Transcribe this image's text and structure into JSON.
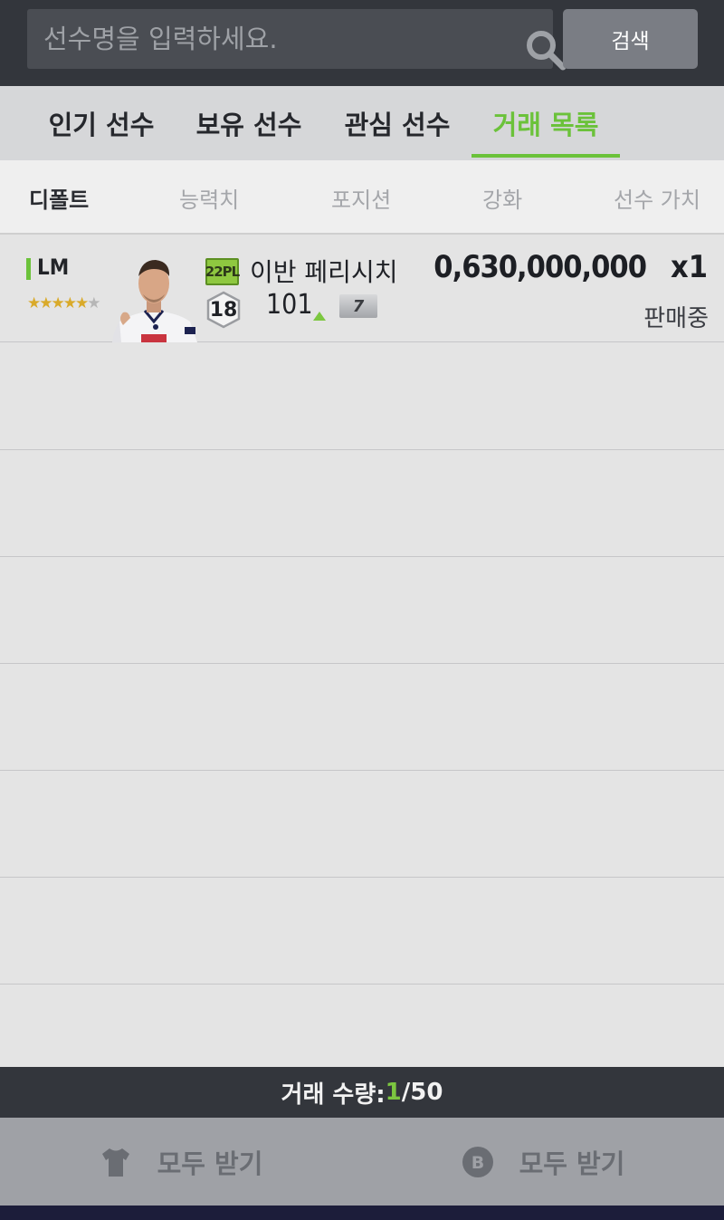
{
  "search": {
    "placeholder": "선수명을 입력하세요.",
    "button_label": "검색",
    "icon": "search-icon"
  },
  "tabs": [
    {
      "label": "인기 선수",
      "active": false
    },
    {
      "label": "보유 선수",
      "active": false
    },
    {
      "label": "관심 선수",
      "active": false
    },
    {
      "label": "거래 목록",
      "active": true
    }
  ],
  "sort_options": [
    {
      "label": "디폴트",
      "active": true
    },
    {
      "label": "능력치",
      "active": false
    },
    {
      "label": "포지션",
      "active": false
    },
    {
      "label": "강화",
      "active": false
    },
    {
      "label": "선수 가치",
      "active": false
    }
  ],
  "trades": [
    {
      "position": "LM",
      "stars": 5,
      "season": "22PL",
      "name": "이반 페리시치",
      "grade": "18",
      "ovr": "101",
      "upgrade": "7",
      "price": "0,630,000,000",
      "quantity": "x1",
      "status": "판매중"
    }
  ],
  "footer": {
    "count_label": "거래 수량: ",
    "count_current": "1",
    "count_total": "/50",
    "claim_players_label": "모두 받기",
    "claim_bp_label": "모두 받기",
    "bp_icon_letter": "B"
  },
  "colors": {
    "accent_green": "#6bc23a",
    "dark_bar": "#33363c",
    "list_bg": "#e4e4e4"
  }
}
